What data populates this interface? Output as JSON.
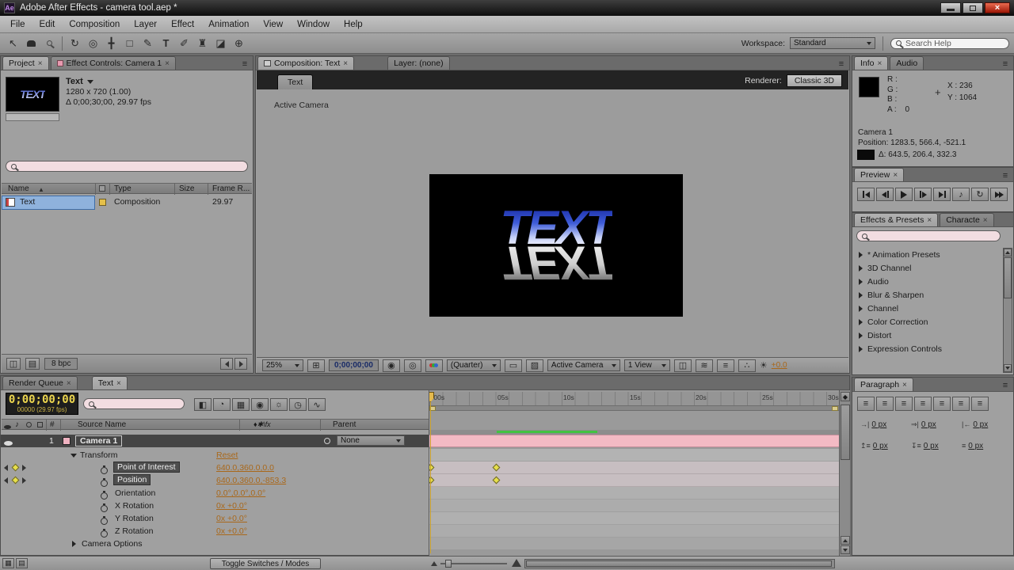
{
  "colors": {
    "value_orange": "#a9681b",
    "timecode_yellow": "#ecd54e",
    "layer_bar_pink": "#f3bac4",
    "ram_preview_green": "#41c341",
    "keyframe_yellow": "#e6df4b",
    "selection_blue": "#8fb2dc"
  },
  "icons": {
    "app_logo": "Ae",
    "selection_tool": "↖",
    "rotation_tool": "↻",
    "camera_tool": "◎",
    "pan_behind_tool": "╋",
    "mask_tool": "□",
    "pen_tool": "✎",
    "type_tool": "T",
    "brush_tool": "✐",
    "clone_stamp_tool": "♜",
    "eraser_tool": "◪",
    "puppet_tool": "⊕",
    "audio_note": "♪",
    "loop": "↻",
    "pickwhip": "@",
    "grid": "⊞",
    "snapshot": "◉",
    "show_snapshot": "◎",
    "roi": "▭",
    "transparency_grid": "▨",
    "pixel_aspect": "◫",
    "fast_previews": "≋",
    "timeline_button": "≡",
    "comp_flowchart": "∴",
    "exposure_icon": "☀",
    "draft_3d": "◧",
    "hide_shy": "◔",
    "frame_blend": "▦",
    "motion_blur": "◉",
    "brainstorm": "☼",
    "auto_keyframe": "◷",
    "graph_editor": "∿",
    "interpret_footage": "◫",
    "new_folder": "▤",
    "status_grid": "▦",
    "status_list": "▤",
    "sort_column": "▲"
  },
  "titlebar": {
    "title": "Adobe After Effects - camera tool.aep *"
  },
  "menu": {
    "items": [
      "File",
      "Edit",
      "Composition",
      "Layer",
      "Effect",
      "Animation",
      "View",
      "Window",
      "Help"
    ]
  },
  "toolbar": {
    "workspace_label": "Workspace:",
    "workspace_value": "Standard",
    "search_help": "Search Help"
  },
  "project_panel": {
    "tab_project": "Project",
    "tab_effect_controls": "Effect Controls: Camera 1",
    "selected_item": {
      "name": "Text",
      "dimensions": "1280 x 720 (1.00)",
      "duration": "Δ 0;00;30;00, 29.97 fps",
      "thumbnail_text": "TEXT"
    },
    "columns": {
      "name": "Name",
      "type": "Type",
      "size": "Size",
      "frame_rate": "Frame R..."
    },
    "row": {
      "name": "Text",
      "type": "Composition",
      "frame_rate": "29.97"
    },
    "bit_depth": "8 bpc"
  },
  "composition_panel": {
    "tab_composition": "Composition: Text",
    "tab_layer": "Layer: (none)",
    "viewer_tab": "Text",
    "renderer_label": "Renderer:",
    "renderer_value": "Classic 3D",
    "view_label": "Active Camera",
    "canvas_text": "TEXT",
    "controls": {
      "zoom": "25%",
      "timecode": "0;00;00;00",
      "resolution": "(Quarter)",
      "camera": "Active Camera",
      "views": "1 View",
      "exposure": "+0.0"
    }
  },
  "info_panel": {
    "tab_info": "Info",
    "tab_audio": "Audio",
    "r_label": "R :",
    "g_label": "G :",
    "b_label": "B :",
    "a_label": "A :",
    "a_value": "0",
    "x_value": "X : 236",
    "y_value": "Y : 1064",
    "layer_name": "Camera 1",
    "position": "Position: 1283.5, 566.4, -521.1",
    "delta": "Δ: 643.5, 206.4, 332.3"
  },
  "preview_panel": {
    "tab": "Preview",
    "buttons": [
      "first-frame",
      "previous-frame",
      "play",
      "next-frame",
      "last-frame",
      "audio",
      "loop",
      "ram-preview"
    ]
  },
  "effects_panel": {
    "tab_effects": "Effects & Presets",
    "tab_character": "Characte",
    "categories": [
      "* Animation Presets",
      "3D Channel",
      "Audio",
      "Blur & Sharpen",
      "Channel",
      "Color Correction",
      "Distort",
      "Expression Controls"
    ]
  },
  "paragraph_panel": {
    "tab": "Paragraph",
    "fields": [
      "0 px",
      "0 px",
      "0 px",
      "0 px",
      "0 px",
      "0 px"
    ]
  },
  "timeline_panel": {
    "tab_render_queue": "Render Queue",
    "tab_text": "Text",
    "timecode": "0;00;00;00",
    "frame_info": "00000 (29.97 fps)",
    "columns": {
      "layer_number": "#",
      "source_name": "Source Name",
      "switches": "♦✱\\fx",
      "parent": "Parent"
    },
    "layer": {
      "number": "1",
      "name": "Camera 1",
      "parent_value": "None"
    },
    "properties": [
      {
        "label": "Transform",
        "value": "Reset"
      },
      {
        "label": "Point of Interest",
        "value": "640.0,360.0,0.0"
      },
      {
        "label": "Position",
        "value": "640.0,360.0,-853.3"
      },
      {
        "label": "Orientation",
        "value": "0.0°,0.0°,0.0°"
      },
      {
        "label": "X Rotation",
        "value": "0x +0.0°"
      },
      {
        "label": "Y Rotation",
        "value": "0x +0.0°"
      },
      {
        "label": "Z Rotation",
        "value": "0x +0.0°"
      },
      {
        "label": "Camera Options",
        "value": ""
      }
    ],
    "ruler_labels": [
      ":00s",
      "05s",
      "10s",
      "15s",
      "20s",
      "25s",
      "30s"
    ],
    "keyframe_times": [
      "0;00;00;00",
      "0;00;05;00"
    ],
    "toggle_button": "Toggle Switches / Modes"
  }
}
